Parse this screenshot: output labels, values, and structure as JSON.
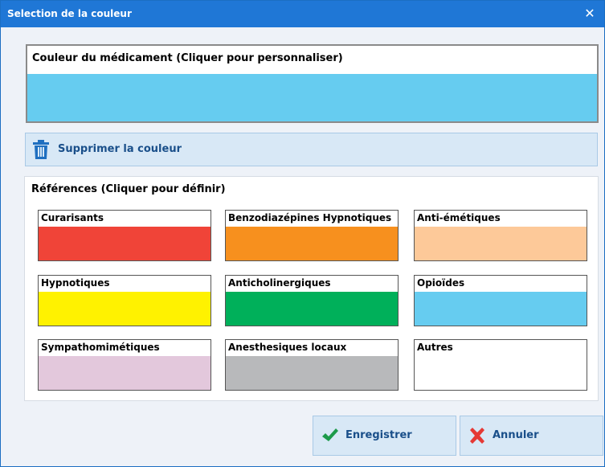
{
  "window": {
    "title": "Selection de la couleur",
    "close_glyph": "✕",
    "close_icon": "close-icon"
  },
  "current_color": {
    "label": "Couleur du médicament (Cliquer pour personnaliser)",
    "color": "#66ccf0"
  },
  "remove_button": {
    "label": "Supprimer la couleur",
    "icon": "trash-icon",
    "icon_color": "#1f6fc0"
  },
  "references": {
    "title": "Références (Cliquer pour définir)",
    "items": [
      {
        "label": "Curarisants",
        "color": "#f04438"
      },
      {
        "label": "Benzodiazépines Hypnotiques",
        "color": "#f7901e"
      },
      {
        "label": "Anti-émétiques",
        "color": "#fdc999"
      },
      {
        "label": "Hypnotiques",
        "color": "#fff200"
      },
      {
        "label": "Anticholinergiques",
        "color": "#00b05a"
      },
      {
        "label": "Opioïdes",
        "color": "#66ccf0"
      },
      {
        "label": "Sympathomimétiques",
        "color": "#e3c8dc"
      },
      {
        "label": "Anesthesiques locaux",
        "color": "#b8b9bb"
      },
      {
        "label": "Autres",
        "color": "#ffffff"
      }
    ]
  },
  "buttons": {
    "save": {
      "label": "Enregistrer",
      "icon": "checkmark-icon",
      "icon_color": "#1c9a4a"
    },
    "cancel": {
      "label": "Annuler",
      "icon": "cross-icon",
      "icon_color": "#e53935"
    }
  },
  "colors": {
    "titlebar": "#1f77d6",
    "button_bg": "#d8e8f6",
    "button_text": "#1a4f8a"
  }
}
